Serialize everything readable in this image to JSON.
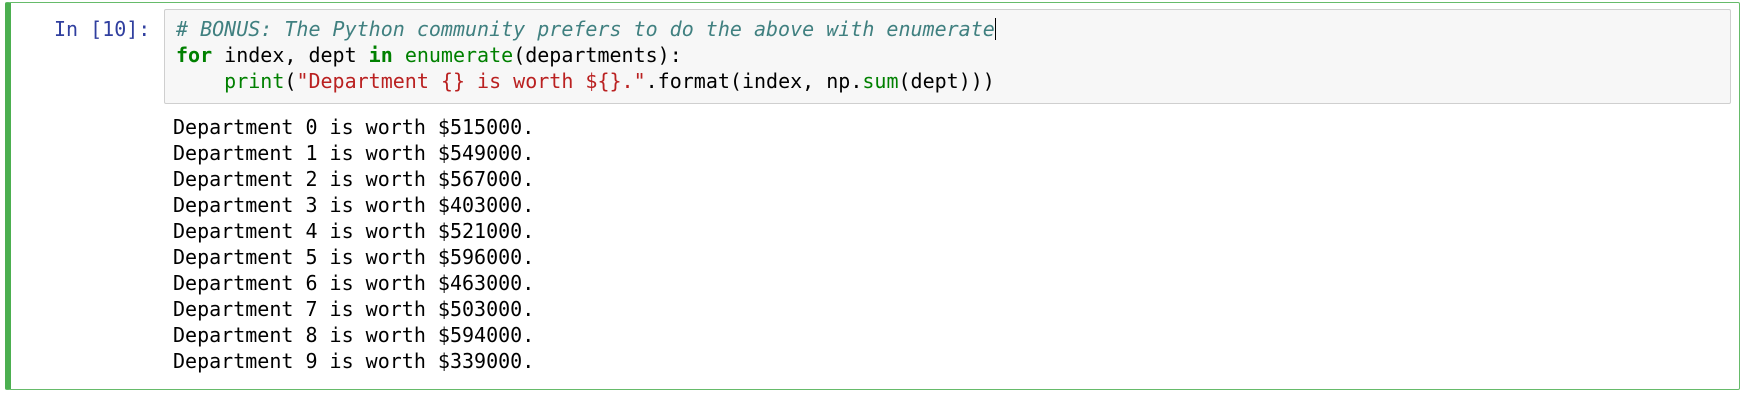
{
  "cell": {
    "prompt": "In [10]:",
    "code_lines": [
      [
        {
          "text": "# BONUS: The Python community prefers to do the above with enumerate",
          "type": "comment"
        }
      ],
      [
        {
          "text": "for",
          "type": "kw"
        },
        {
          "text": " index, dept ",
          "type": "plain"
        },
        {
          "text": "in",
          "type": "kw"
        },
        {
          "text": " ",
          "type": "plain"
        },
        {
          "text": "enumerate",
          "type": "builtin"
        },
        {
          "text": "(departments):",
          "type": "plain"
        }
      ],
      [
        {
          "text": "    ",
          "type": "plain"
        },
        {
          "text": "print",
          "type": "builtin"
        },
        {
          "text": "(",
          "type": "plain"
        },
        {
          "text": "\"Department {} is worth ${}.\"",
          "type": "str"
        },
        {
          "text": ".format(index, np.",
          "type": "plain"
        },
        {
          "text": "sum",
          "type": "builtin"
        },
        {
          "text": "(dept)))",
          "type": "plain"
        }
      ]
    ],
    "output_lines": [
      "Department 0 is worth $515000.",
      "Department 1 is worth $549000.",
      "Department 2 is worth $567000.",
      "Department 3 is worth $403000.",
      "Department 4 is worth $521000.",
      "Department 5 is worth $596000.",
      "Department 6 is worth $463000.",
      "Department 7 is worth $503000.",
      "Department 8 is worth $594000.",
      "Department 9 is worth $339000."
    ]
  },
  "colors": {
    "cell_border_selected": "#4caf50",
    "prompt_in": "#303f9f",
    "comment": "#408080",
    "keyword": "#008000",
    "string": "#ba2121",
    "input_background": "#f7f7f7"
  }
}
